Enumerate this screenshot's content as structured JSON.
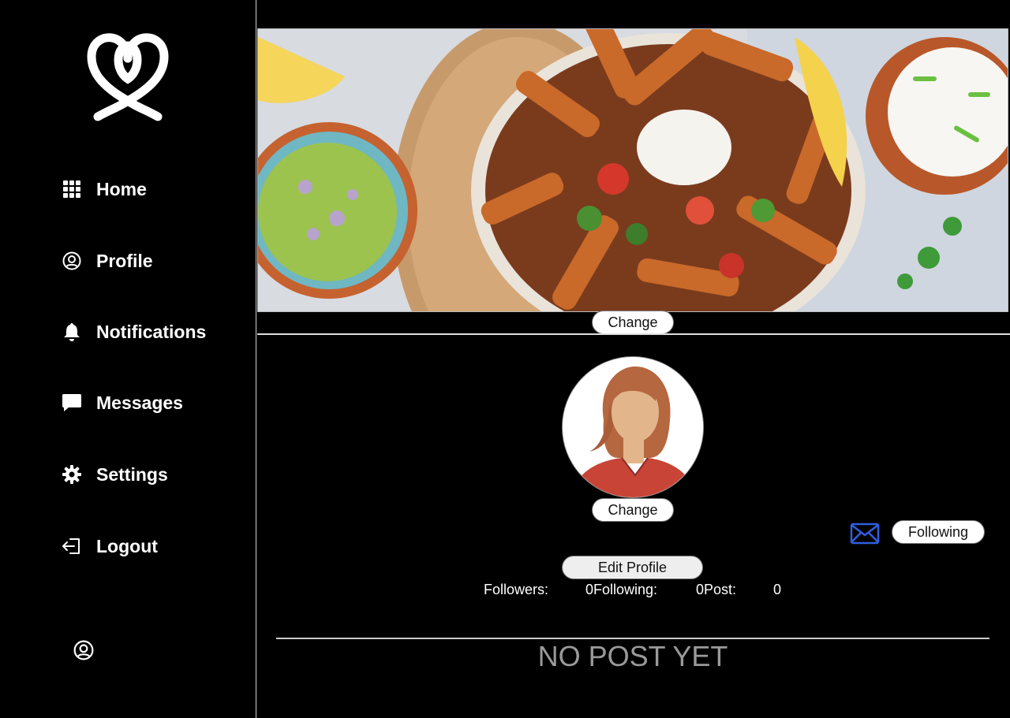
{
  "sidebar": {
    "logo_icon": "double-heart-logo-icon",
    "items": [
      {
        "label": "Home",
        "icon": "grid-icon"
      },
      {
        "label": "Profile",
        "icon": "user-circle-icon"
      },
      {
        "label": "Notifications",
        "icon": "bell-icon"
      },
      {
        "label": "Messages",
        "icon": "chat-bubble-icon"
      },
      {
        "label": "Settings",
        "icon": "gear-icon"
      },
      {
        "label": "Logout",
        "icon": "logout-icon"
      }
    ],
    "account_icon": "user-circle-icon"
  },
  "profile": {
    "cover_change_label": "Change",
    "avatar_change_label": "Change",
    "following_label": "Following",
    "mail_icon": "envelope-icon",
    "edit_profile_label": "Edit Profile",
    "stats": {
      "followers_label": "Followers:",
      "followers_value": "0",
      "following_label": "Following:",
      "following_value": "0",
      "posts_label": "Post:",
      "posts_value": "0"
    },
    "empty_message": "NO POST YET"
  },
  "colors": {
    "background": "#000000",
    "accent_mail": "#2f5fe0",
    "empty_text": "#9a9a9a",
    "avatar_shirt": "#c84437",
    "avatar_hair": "#b5673f",
    "avatar_skin": "#e2b68a"
  }
}
